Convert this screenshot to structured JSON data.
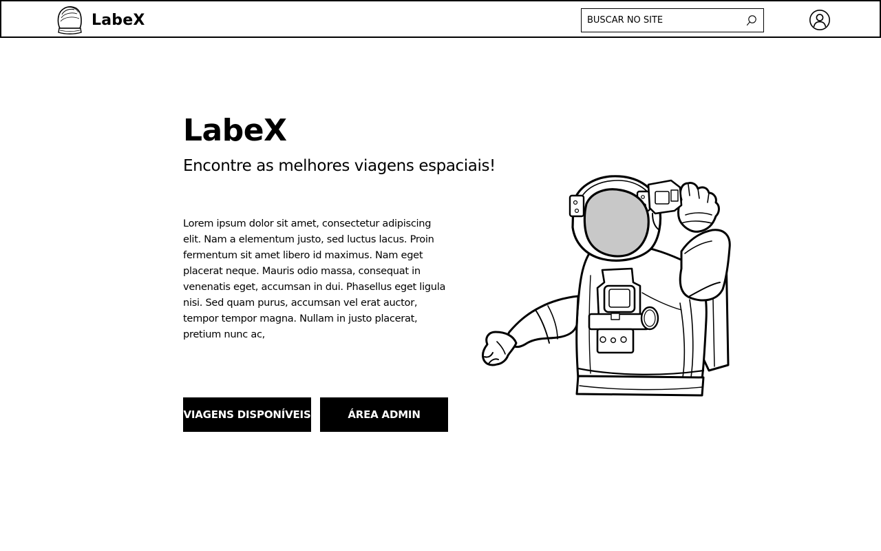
{
  "header": {
    "brand_name": "LabeX",
    "logo_icon": "astronaut-helmet-icon",
    "search": {
      "placeholder": "BUSCAR NO SITE",
      "value": "",
      "icon": "search-icon"
    },
    "user_icon": "user-account-icon"
  },
  "hero": {
    "title": "LabeX",
    "subtitle": "Encontre as melhores viagens espaciais!",
    "body": "Lorem ipsum dolor sit amet, consectetur adipiscing elit. Nam a elementum justo, sed luctus lacus. Proin fermentum sit amet libero id maximus. Nam eget placerat neque. Mauris odio massa, consequat in venenatis eget, accumsan in dui. Phasellus eget ligula nisi. Sed quam purus, accumsan vel erat auctor, tempor tempor magna. Nullam in justo placerat, pretium nunc ac,",
    "buttons": {
      "trips_label": "VIAGENS DISPONÍVEIS",
      "admin_label": "ÁREA ADMIN"
    },
    "illustration": "astronaut-illustration"
  },
  "colors": {
    "background": "#ffffff",
    "foreground": "#000000",
    "button_bg": "#000000",
    "button_text": "#ffffff",
    "visor": "#c8c8c8"
  }
}
